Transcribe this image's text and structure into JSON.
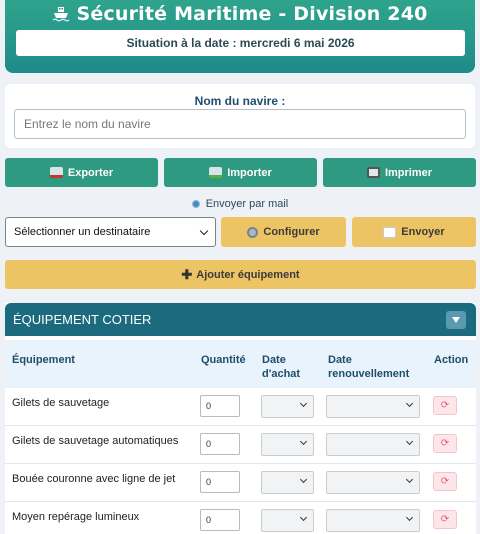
{
  "header": {
    "title": "Sécurité Maritime - Division 240",
    "ship_icon": "ship-icon",
    "date_text": "Situation à la date : mercredi 6 mai 2026"
  },
  "vessel": {
    "label": "Nom du navire :",
    "placeholder": "Entrez le nom du navire",
    "value": ""
  },
  "actions": {
    "export_label": "Exporter",
    "import_label": "Importer",
    "print_label": "Imprimer"
  },
  "mail": {
    "label": "Envoyer par mail",
    "recipient_selected": "Sélectionner un destinataire",
    "configure_label": "Configurer",
    "send_label": "Envoyer"
  },
  "add_equipment_label": "Ajouter équipement",
  "section": {
    "title": "ÉQUIPEMENT COTIER",
    "columns": {
      "equipment": "Équipement",
      "quantity": "Quantité",
      "purchase_line1": "Date",
      "purchase_line2": "d'achat",
      "renewal_line1": "Date",
      "renewal_line2": "renouvellement",
      "action": "Action"
    },
    "rows": [
      {
        "name": "Gilets de sauvetage",
        "quantity": "0"
      },
      {
        "name": "Gilets de sauvetage automatiques",
        "quantity": "0"
      },
      {
        "name": "Bouée couronne avec ligne de jet",
        "quantity": "0"
      },
      {
        "name": "Moyen repérage lumineux",
        "quantity": "0"
      }
    ]
  },
  "colors": {
    "header_green": "#2fa48c",
    "section_teal": "#1b6a7e",
    "button_green": "#2e9a82",
    "button_yellow": "#ecc463"
  }
}
